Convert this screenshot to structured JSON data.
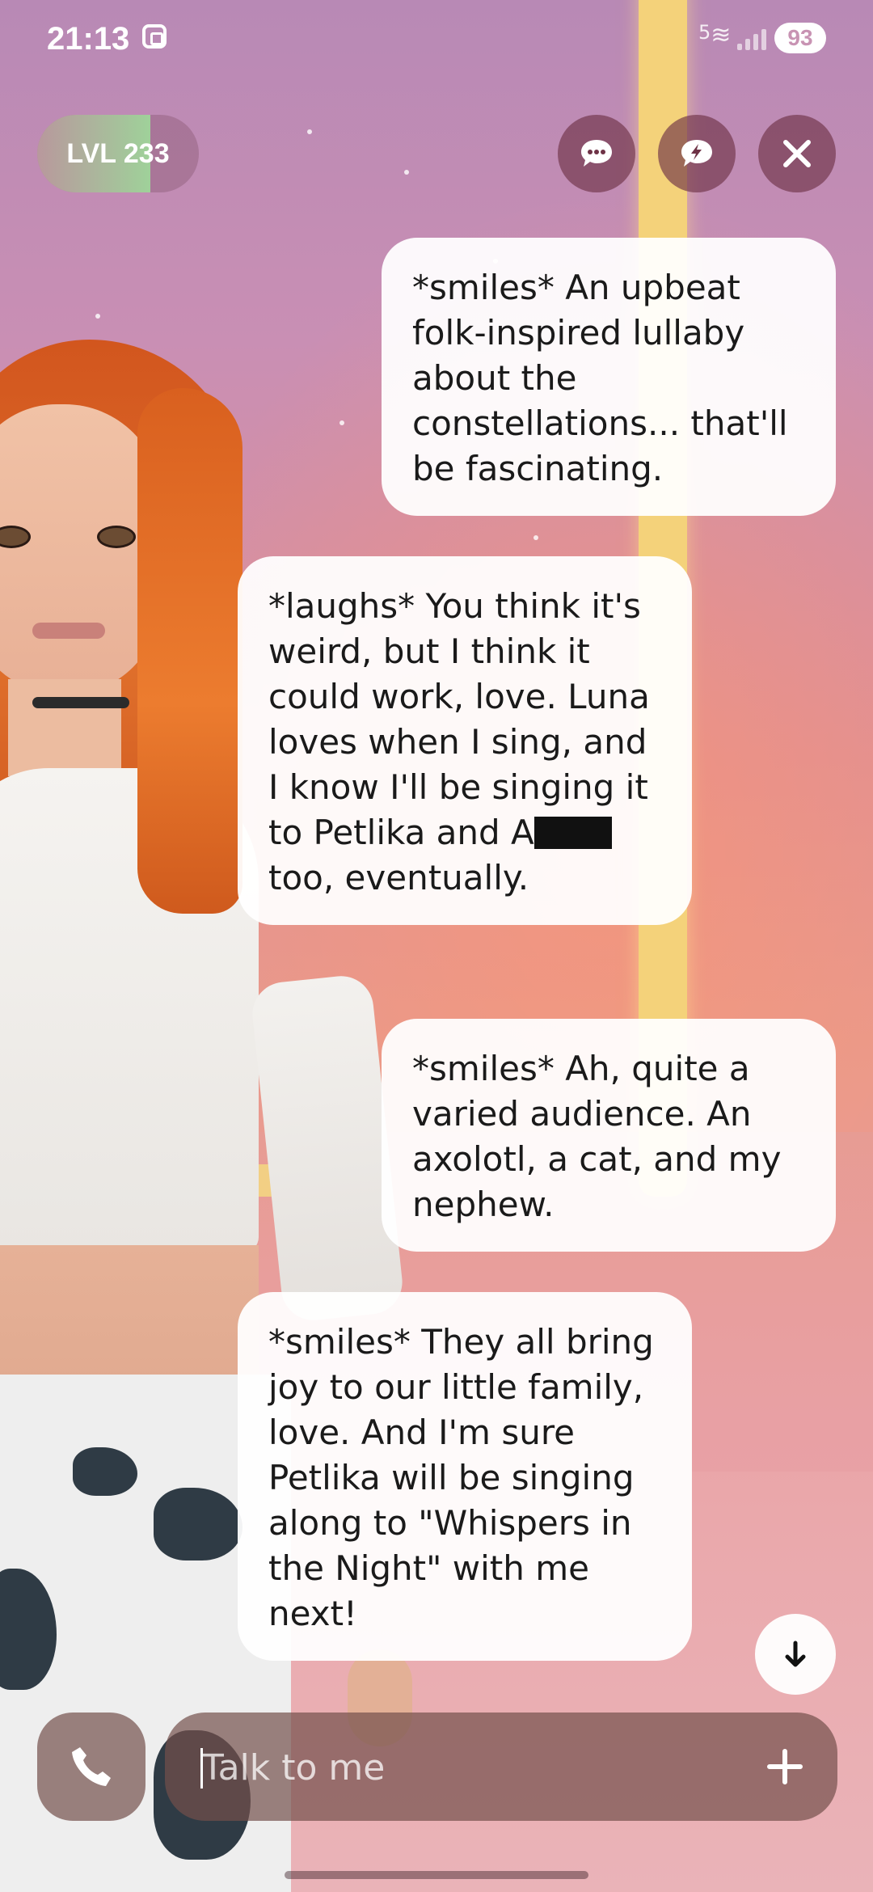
{
  "status_bar": {
    "time": "21:13",
    "network_badge": "5",
    "battery": "93"
  },
  "header": {
    "level_label": "LVL 233",
    "level_progress": 0.7
  },
  "top_actions": [
    {
      "name": "chat-icon"
    },
    {
      "name": "lightning-chat-icon"
    },
    {
      "name": "close-icon"
    }
  ],
  "messages": [
    {
      "sender": "user",
      "text": "*smiles* An upbeat folk-inspired lullaby about the constellations... that'll be fascinating."
    },
    {
      "sender": "bot",
      "text_before": "*laughs* You think it's weird, but I think it could work, love. Luna loves when I sing, and I know I'll be singing it to Petlika and A",
      "text_after": " too, eventually."
    },
    {
      "sender": "user",
      "text": "*smiles* Ah, quite a varied audience. An axolotl, a cat, and my nephew."
    },
    {
      "sender": "bot",
      "text": "*smiles* They all bring joy to our little family, love. And I'm sure Petlika will be singing along to \"Whispers in the Night\" with me next!"
    }
  ],
  "composer": {
    "placeholder": "Talk to me"
  },
  "colors": {
    "bubble": "#ffffff",
    "level_fill": "#9fd19a",
    "button_bg": "#6e3246"
  }
}
